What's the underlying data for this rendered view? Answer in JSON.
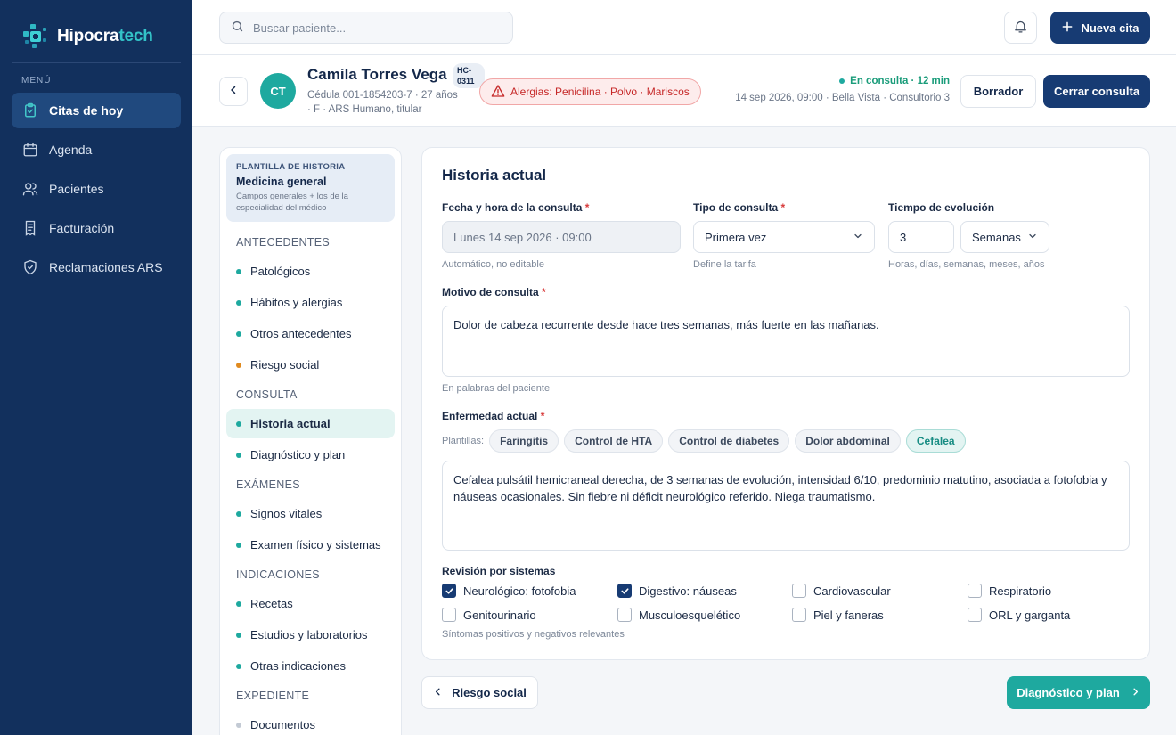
{
  "brand": {
    "name_part1": "Hipocra",
    "name_part2": "tech",
    "logo_icon": "hipocratech-logo"
  },
  "sidebar": {
    "menu_title": "MENÚ",
    "items": [
      {
        "label": "Citas de hoy",
        "icon": "clipboard-icon",
        "active": true
      },
      {
        "label": "Agenda",
        "icon": "calendar-icon",
        "active": false
      },
      {
        "label": "Pacientes",
        "icon": "users-icon",
        "active": false
      },
      {
        "label": "Facturación",
        "icon": "receipt-icon",
        "active": false
      },
      {
        "label": "Reclamaciones ARS",
        "icon": "shield-icon",
        "active": false
      }
    ]
  },
  "topbar": {
    "search_placeholder": "Buscar paciente...",
    "new_appointment_label": "Nueva cita"
  },
  "patient": {
    "initials": "CT",
    "name": "Camila Torres Vega",
    "record_id": "HC-0311",
    "meta": "Cédula 001-1854203-7 · 27 años · F · ARS Humano, titular",
    "allergies": "Alergias: Penicilina · Polvo · Mariscos",
    "status": "En consulta · 12 min",
    "appointment": "14 sep 2026, 09:00 · Bella Vista · Consultorio 3",
    "draft_label": "Borrador",
    "close_label": "Cerrar consulta"
  },
  "sections": {
    "template_label": "PLANTILLA DE HISTORIA",
    "template_name": "Medicina general",
    "template_desc": "Campos generales + los de la especialidad del médico",
    "groups": [
      {
        "title": "ANTECEDENTES",
        "items": [
          {
            "label": "Patológicos",
            "dot": "#1ea99f",
            "active": false
          },
          {
            "label": "Hábitos y alergias",
            "dot": "#1ea99f",
            "active": false
          },
          {
            "label": "Otros antecedentes",
            "dot": "#1ea99f",
            "active": false
          },
          {
            "label": "Riesgo social",
            "dot": "#e08a1e",
            "active": false
          }
        ]
      },
      {
        "title": "CONSULTA",
        "items": [
          {
            "label": "Historia actual",
            "dot": "#1ea99f",
            "active": true
          },
          {
            "label": "Diagnóstico y plan",
            "dot": "#1ea99f",
            "active": false
          }
        ]
      },
      {
        "title": "EXÁMENES",
        "items": [
          {
            "label": "Signos vitales",
            "dot": "#1ea99f",
            "active": false
          },
          {
            "label": "Examen físico y sistemas",
            "dot": "#1ea99f",
            "active": false
          }
        ]
      },
      {
        "title": "INDICACIONES",
        "items": [
          {
            "label": "Recetas",
            "dot": "#1ea99f",
            "active": false
          },
          {
            "label": "Estudios y laboratorios",
            "dot": "#1ea99f",
            "active": false
          },
          {
            "label": "Otras indicaciones",
            "dot": "#1ea99f",
            "active": false
          }
        ]
      },
      {
        "title": "EXPEDIENTE",
        "items": [
          {
            "label": "Documentos",
            "dot": "#c3cad4",
            "active": false
          }
        ]
      }
    ]
  },
  "form": {
    "title": "Historia actual",
    "datetime_label": "Fecha y hora de la consulta",
    "datetime_value": "Lunes 14 sep 2026 · 09:00",
    "datetime_help": "Automático, no editable",
    "type_label": "Tipo de consulta",
    "type_value": "Primera vez",
    "type_help": "Define la tarifa",
    "evolution_label": "Tiempo de evolución",
    "evolution_value": "3",
    "evolution_unit": "Semanas",
    "evolution_help": "Horas, días, semanas, meses, años",
    "reason_label": "Motivo de consulta",
    "reason_value": "Dolor de cabeza recurrente desde hace tres semanas, más fuerte en las mañanas.",
    "reason_help": "En palabras del paciente",
    "illness_label": "Enfermedad actual",
    "templates_label": "Plantillas:",
    "templates": [
      {
        "label": "Faringitis",
        "active": false
      },
      {
        "label": "Control de HTA",
        "active": false
      },
      {
        "label": "Control de diabetes",
        "active": false
      },
      {
        "label": "Dolor abdominal",
        "active": false
      },
      {
        "label": "Cefalea",
        "active": true
      }
    ],
    "illness_value": "Cefalea pulsátil hemicraneal derecha, de 3 semanas de evolución, intensidad 6/10, predominio matutino, asociada a fotofobia y náuseas ocasionales. Sin fiebre ni déficit neurológico referido. Niega traumatismo.",
    "review_label": "Revisión por sistemas",
    "review_items": [
      {
        "label": "Neurológico: fotofobia",
        "checked": true
      },
      {
        "label": "Digestivo: náuseas",
        "checked": true
      },
      {
        "label": "Cardiovascular",
        "checked": false
      },
      {
        "label": "Respiratorio",
        "checked": false
      },
      {
        "label": "Genitourinario",
        "checked": false
      },
      {
        "label": "Musculoesquelético",
        "checked": false
      },
      {
        "label": "Piel y faneras",
        "checked": false
      },
      {
        "label": "ORL y garganta",
        "checked": false
      }
    ],
    "review_help": "Síntomas positivos y negativos relevantes",
    "required_mark": "*"
  },
  "footer": {
    "prev_label": "Riesgo social",
    "next_label": "Diagnóstico y plan"
  }
}
